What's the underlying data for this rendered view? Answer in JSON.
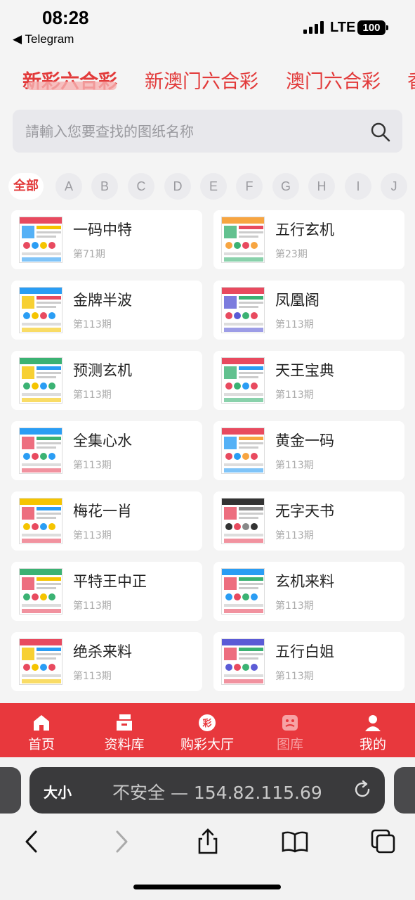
{
  "status": {
    "time": "08:28",
    "back_app": "◀ Telegram",
    "network": "LTE",
    "battery": "100"
  },
  "tabs": [
    {
      "label": "新彩六合彩",
      "active": true
    },
    {
      "label": "新澳门六合彩",
      "active": false
    },
    {
      "label": "澳门六合彩",
      "active": false
    },
    {
      "label": "香",
      "active": false
    }
  ],
  "search": {
    "placeholder": "請輸入您要查找的图纸名称",
    "icon": "search-icon"
  },
  "letters": [
    "全部",
    "A",
    "B",
    "C",
    "D",
    "E",
    "F",
    "G",
    "H",
    "I",
    "J"
  ],
  "items": [
    {
      "title": "一码中特",
      "issue": "第71期"
    },
    {
      "title": "五行玄机",
      "issue": "第23期"
    },
    {
      "title": "金牌半波",
      "issue": "第113期"
    },
    {
      "title": "凤凰阁",
      "issue": "第113期"
    },
    {
      "title": "预测玄机",
      "issue": "第113期"
    },
    {
      "title": "天王宝典",
      "issue": "第113期"
    },
    {
      "title": "全集心水",
      "issue": "第113期"
    },
    {
      "title": "黄金一码",
      "issue": "第113期"
    },
    {
      "title": "梅花一肖",
      "issue": "第113期"
    },
    {
      "title": "无字天书",
      "issue": "第113期"
    },
    {
      "title": "平特王中正",
      "issue": "第113期"
    },
    {
      "title": "玄机来料",
      "issue": "第113期"
    },
    {
      "title": "绝杀来料",
      "issue": "第113期"
    },
    {
      "title": "五行白姐",
      "issue": "第113期"
    }
  ],
  "nav": [
    {
      "label": "首页",
      "icon": "home-icon",
      "active": false
    },
    {
      "label": "资料库",
      "icon": "archive-icon",
      "active": false
    },
    {
      "label": "购彩大厅",
      "icon": "lottery-icon",
      "active": false,
      "badge": "彩"
    },
    {
      "label": "图库",
      "icon": "gallery-icon",
      "active": true
    },
    {
      "label": "我的",
      "icon": "user-icon",
      "active": false
    }
  ],
  "browser": {
    "text_size": "大小",
    "url": "不安全 — 154.82.115.69"
  },
  "colors": {
    "accent": "#e23a3a",
    "nav_bg": "#e8383d",
    "page_bg": "#f4f4f4"
  }
}
